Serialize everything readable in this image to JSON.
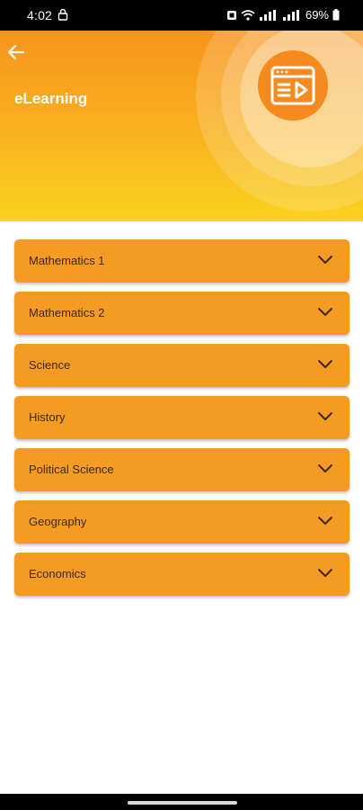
{
  "status_bar": {
    "time": "4:02",
    "battery": "69%"
  },
  "header": {
    "title": "eLearning",
    "back_icon": "arrow-left-icon",
    "hero_icon": "video-course-icon",
    "colors": {
      "gradient_top": "#f7941d",
      "gradient_bottom": "#fbd21f",
      "icon_circle": "#f58a1f"
    }
  },
  "subjects": [
    {
      "label": "Mathematics 1"
    },
    {
      "label": "Mathematics 2"
    },
    {
      "label": "Science"
    },
    {
      "label": "History"
    },
    {
      "label": "Political Science"
    },
    {
      "label": "Geography"
    },
    {
      "label": "Economics"
    }
  ],
  "subject_item_color": "#f59a23",
  "subject_chevron_icon": "chevron-down-icon"
}
